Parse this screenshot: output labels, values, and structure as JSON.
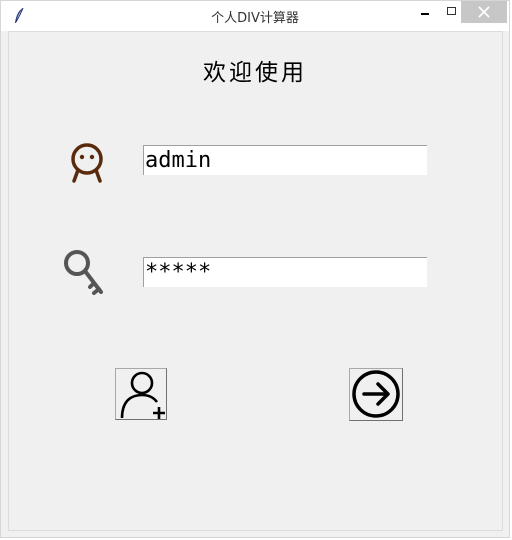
{
  "window": {
    "title": "个人DIV计算器",
    "app_icon": "feather-icon",
    "controls": {
      "minimize": "minimize-icon",
      "maximize": "maximize-icon",
      "close": "close-icon"
    }
  },
  "login": {
    "welcome": "欢迎使用",
    "user_icon": "user-face-icon",
    "username_value": "admin",
    "password_icon": "key-icon",
    "password_masked": "*****",
    "register_icon": "add-user-icon",
    "login_icon": "arrow-right-circle-icon"
  },
  "colors": {
    "window_bg": "#f0f0f0",
    "titlebar_bg": "#ffffff",
    "user_icon": "#5a2a0c",
    "key_icon": "#555555",
    "close_bg": "#c7c7c7"
  }
}
